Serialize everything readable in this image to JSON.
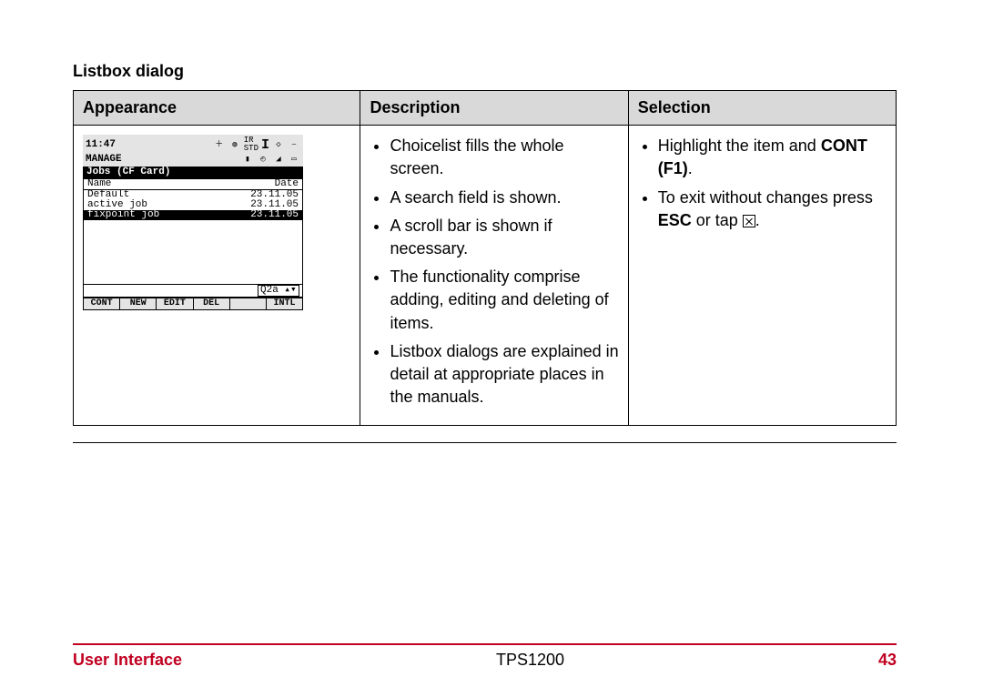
{
  "section_title": "Listbox dialog",
  "table": {
    "headers": [
      "Appearance",
      "Description",
      "Selection"
    ]
  },
  "device": {
    "time": "11:47",
    "title_left": "MANAGE",
    "ir_label": "IR",
    "std_label": "STD",
    "ir_big": "I",
    "subtitle": "Jobs (CF Card)",
    "col_name": "Name",
    "col_date": "Date",
    "rows": [
      {
        "name": "Default",
        "date": "23.11.05",
        "selected": false
      },
      {
        "name": "active job",
        "date": "23.11.05",
        "selected": false
      },
      {
        "name": "fixpoint job",
        "date": "23.11.05",
        "selected": true
      }
    ],
    "search_value": "Q2a",
    "softkeys": [
      "CONT",
      "NEW",
      "EDIT",
      "DEL",
      "",
      "INTL"
    ]
  },
  "description": {
    "items": [
      "Choicelist fills the whole screen.",
      "A search field is shown.",
      "A scroll bar is shown if necessary.",
      "The functionality comprise adding, editing and deleting of items.",
      "Listbox dialogs are explained in detail at appropriate places in the manuals."
    ]
  },
  "selection": {
    "item1_pre": "Highlight the item and ",
    "item1_bold": "CONT (F1)",
    "item1_post": ".",
    "item2_pre": "To exit without changes press ",
    "item2_bold": "ESC",
    "item2_mid": " or tap ",
    "item2_post": "."
  },
  "footer": {
    "left": "User Interface",
    "center": "TPS1200",
    "right": "43"
  }
}
